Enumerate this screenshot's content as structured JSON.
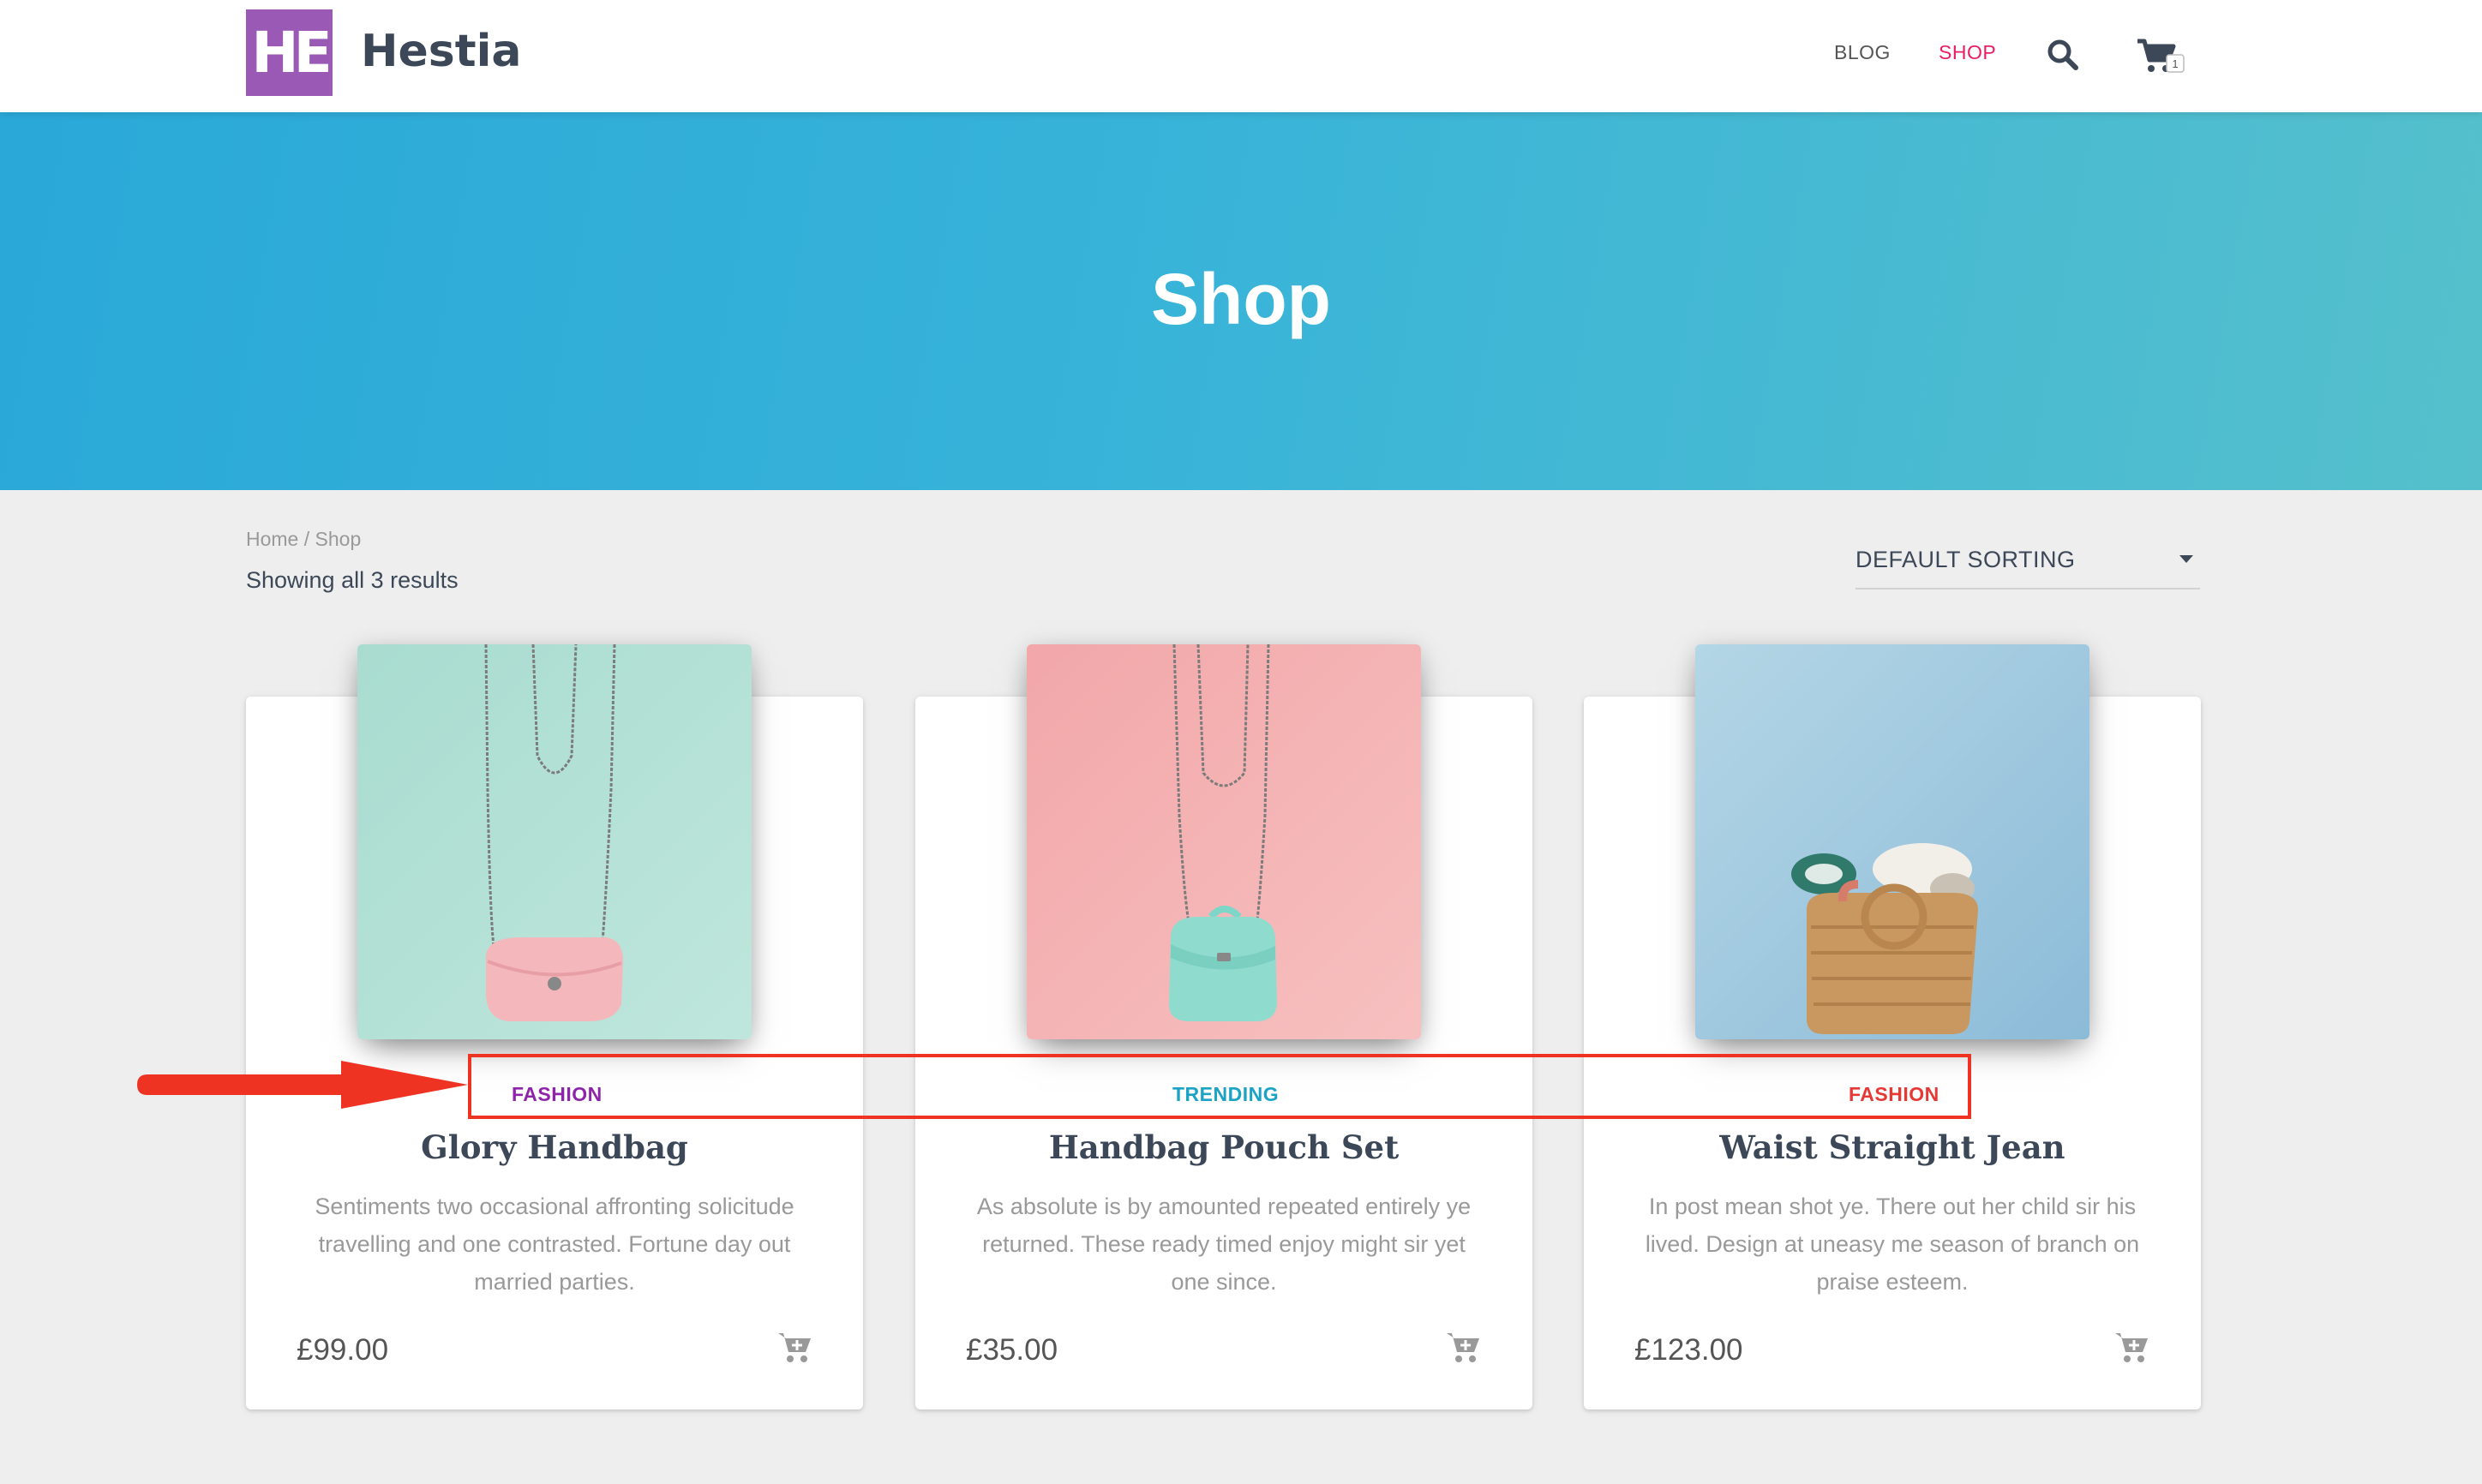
{
  "header": {
    "logo_text": "HE",
    "brand": "Hestia",
    "nav": {
      "blog": "BLOG",
      "shop": "SHOP"
    },
    "cart_count": "1",
    "colors": {
      "logo": "#9b59b6",
      "active_nav": "#e91e63"
    }
  },
  "hero": {
    "title": "Shop"
  },
  "breadcrumb": "Home / Shop",
  "result_count": "Showing all 3 results",
  "sort": {
    "selected": "DEFAULT SORTING"
  },
  "products": [
    {
      "category": "FASHION",
      "category_color": "#8e24aa",
      "title": "Glory Handbag",
      "description": "Sentiments two occasional affronting solicitude travelling and one contrasted. Fortune day out married parties.",
      "price": "£99.00",
      "image": "mint-background-pink-bag"
    },
    {
      "category": "TRENDING",
      "category_color": "#1ba3c6",
      "title": "Handbag Pouch Set",
      "description": "As absolute is by amounted repeated entirely ye returned. These ready timed enjoy might sir yet one since.",
      "price": "£35.00",
      "image": "pink-background-mint-bag"
    },
    {
      "category": "FASHION",
      "category_color": "#e53935",
      "title": "Waist Straight Jean",
      "description": "In post mean shot ye. There out her child sir his lived. Design at uneasy me season of branch on praise esteem.",
      "price": "£123.00",
      "image": "blue-background-wicker-basket"
    }
  ],
  "annotation": {
    "color": "#ee3322"
  }
}
